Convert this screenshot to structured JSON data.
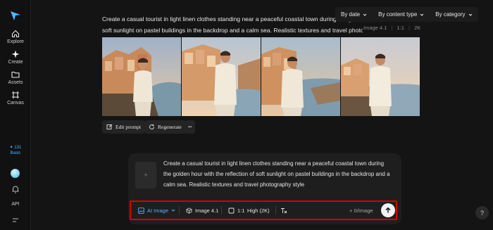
{
  "sidebar": {
    "items": [
      {
        "label": "Explore",
        "icon": "home-icon"
      },
      {
        "label": "Create",
        "icon": "sparkle-icon"
      },
      {
        "label": "Assets",
        "icon": "folder-icon"
      },
      {
        "label": "Canvas",
        "icon": "canvas-icon"
      }
    ],
    "credits": "✦ 131",
    "plan": "Basic",
    "api_label": "API"
  },
  "filters": [
    {
      "label": "By date"
    },
    {
      "label": "By content type"
    },
    {
      "label": "By category"
    }
  ],
  "generation": {
    "prompt_line_1": "Create a casual tourist in light linen clothes standing near a peaceful coastal town during the golden hour with the reflection of",
    "prompt_line_2": "soft sunlight on pastel buildings in the backdrop and a calm sea. Realistic textures and travel photography style",
    "model_tag": "Image 4.1",
    "ratio_tag": "1:1",
    "resolution_tag": "2K",
    "actions": {
      "edit_prompt": "Edit prompt",
      "regenerate": "Regenerate",
      "more": "•••"
    }
  },
  "composer": {
    "upload_icon": "+",
    "prompt_line_1": "Create a casual tourist in light linen clothes standing near a peaceful coastal town during",
    "prompt_line_2": "the golden hour with the reflection of soft sunlight on pastel buildings in the backdrop and a",
    "prompt_line_3": "calm sea. Realistic textures and travel photography style",
    "toolbar": {
      "mode": "AI Image",
      "model": "Image 4.1",
      "ratio": "1:1",
      "quality": "High (2K)",
      "count": "+ 0/Image"
    }
  },
  "help_label": "?",
  "colors": {
    "accent": "#4fb5ff",
    "highlight_border": "#d60000",
    "background": "#141414"
  }
}
